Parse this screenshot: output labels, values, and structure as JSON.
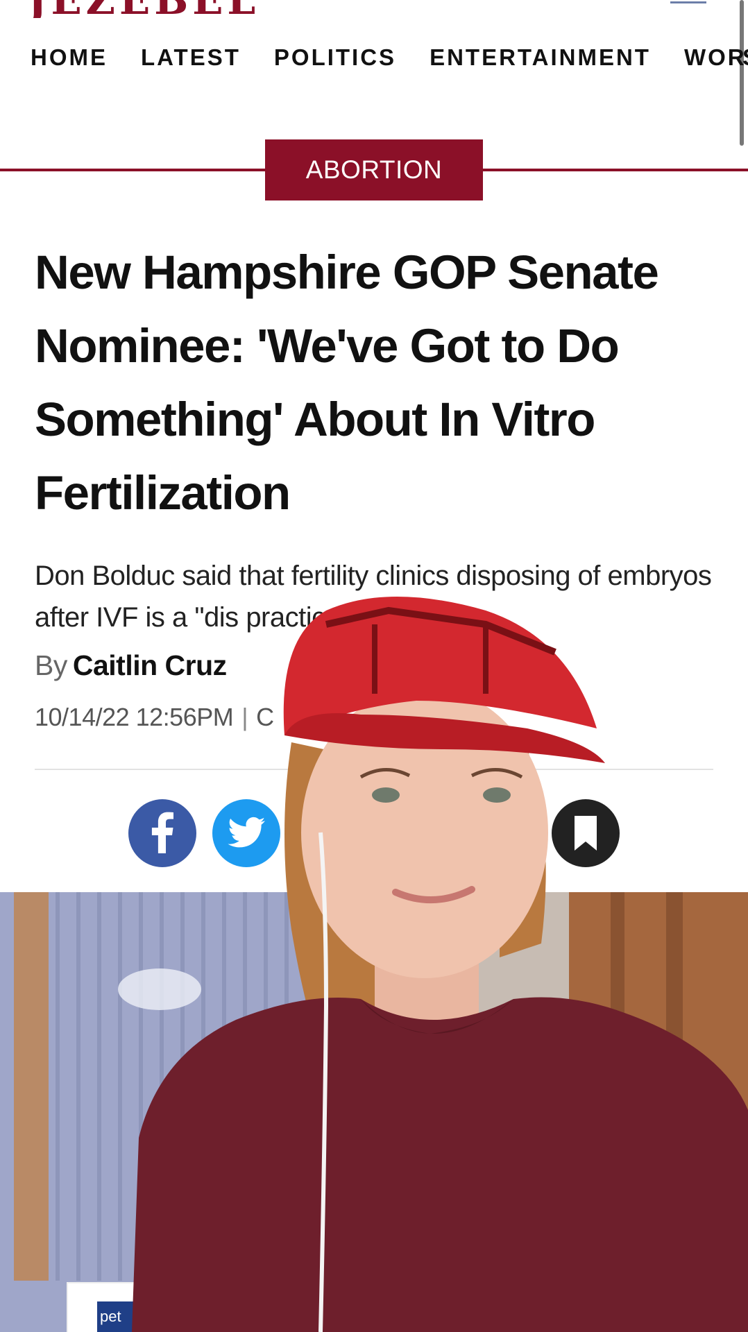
{
  "brand": {
    "logo_alt": "JEZEBEL"
  },
  "nav": {
    "items": [
      "HOME",
      "LATEST",
      "POLITICS",
      "ENTERTAINMENT",
      "WORK"
    ],
    "overflow_hint": "S"
  },
  "article": {
    "category": "ABORTION",
    "headline": "New Hampshire GOP Senate Nominee: 'We've Got to Do Something' About In Vitro Fertilization",
    "dek": "Don Bolduc said that fertility clinics disposing of embryos after IVF is a \"dis",
    "dek_tail": "practice.\"",
    "by_label": "By",
    "author": "Caitlin Cruz",
    "timestamp": "10/14/22 12:56PM",
    "meta_separator": "|",
    "meta_next": "C"
  },
  "share": {
    "facebook_icon": "facebook-icon",
    "twitter_icon": "twitter-icon",
    "bookmark_icon": "bookmark-icon"
  },
  "ad": {
    "text": "pet"
  },
  "colors": {
    "accent": "#8b1028",
    "facebook": "#3b5aa6",
    "twitter": "#1d9bf0",
    "bookmark": "#222222"
  }
}
